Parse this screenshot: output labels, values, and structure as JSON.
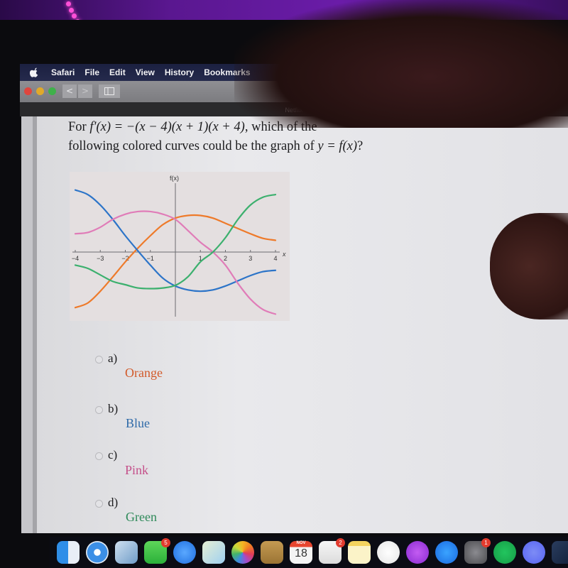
{
  "menubar": {
    "app_name": "Safari",
    "items": [
      "File",
      "Edit",
      "View",
      "History",
      "Bookmarks"
    ]
  },
  "toolbar": {
    "back_label": "<",
    "forward_label": ">"
  },
  "tab": {
    "title": "Netflix"
  },
  "question": {
    "prefix": "For ",
    "function_expr": "f′(x) = −(x − 4)(x + 1)(x + 4)",
    "suffix_line1": ", which of the",
    "line2": "following colored curves could be the graph of ",
    "target_expr": "y = f(x)",
    "end": "?"
  },
  "options": [
    {
      "letter": "a)",
      "label": "Orange",
      "color": "#d25a2a",
      "selected": false
    },
    {
      "letter": "b)",
      "label": "Blue",
      "color": "#2f6aa8",
      "selected": false
    },
    {
      "letter": "c)",
      "label": "Pink",
      "color": "#c4508a",
      "selected": false
    },
    {
      "letter": "d)",
      "label": "Green",
      "color": "#2f8a5a",
      "selected": false
    }
  ],
  "chart_data": {
    "type": "line",
    "title": "f(x)",
    "xlabel": "x",
    "ylabel": "f(x)",
    "xlim": [
      -4,
      4
    ],
    "ylim": [
      -1,
      1
    ],
    "x_ticks": [
      -4,
      -3,
      -2,
      -1,
      1,
      2,
      3,
      4
    ],
    "x_tick_labels": [
      "−4",
      "−3",
      "−2",
      "−1",
      "1",
      "2",
      "3",
      "4"
    ],
    "y_ticks": [],
    "grid": false,
    "legend": "none",
    "x": [
      -4,
      -3.5,
      -3,
      -2.5,
      -2,
      -1.5,
      -1,
      -0.5,
      0,
      0.5,
      1,
      1.5,
      2,
      2.5,
      3,
      3.5,
      4
    ],
    "series": [
      {
        "name": "Orange",
        "color": "#ee7a2a",
        "values": [
          -0.85,
          -0.78,
          -0.6,
          -0.38,
          -0.15,
          0.06,
          0.25,
          0.42,
          0.52,
          0.56,
          0.56,
          0.52,
          0.44,
          0.36,
          0.28,
          0.21,
          0.18
        ]
      },
      {
        "name": "Blue",
        "color": "#2c74c8",
        "values": [
          0.95,
          0.88,
          0.72,
          0.5,
          0.25,
          0.02,
          -0.2,
          -0.4,
          -0.52,
          -0.58,
          -0.6,
          -0.58,
          -0.52,
          -0.44,
          -0.36,
          -0.3,
          -0.28
        ]
      },
      {
        "name": "Pink",
        "color": "#e07cb8",
        "values": [
          0.28,
          0.3,
          0.38,
          0.5,
          0.58,
          0.62,
          0.62,
          0.58,
          0.5,
          0.33,
          0.15,
          0.0,
          -0.2,
          -0.48,
          -0.72,
          -0.88,
          -0.95
        ]
      },
      {
        "name": "Green",
        "color": "#3cb06e",
        "values": [
          -0.2,
          -0.25,
          -0.35,
          -0.45,
          -0.5,
          -0.55,
          -0.56,
          -0.55,
          -0.51,
          -0.38,
          -0.15,
          0.0,
          0.22,
          0.5,
          0.72,
          0.84,
          0.88
        ]
      }
    ]
  },
  "dock": {
    "apps": [
      {
        "name": "Finder",
        "badge": ""
      },
      {
        "name": "Safari",
        "badge": ""
      },
      {
        "name": "Mail",
        "badge": ""
      },
      {
        "name": "FaceTime",
        "badge": "5"
      },
      {
        "name": "Messages",
        "badge": ""
      },
      {
        "name": "Maps",
        "badge": ""
      },
      {
        "name": "Photos",
        "badge": ""
      },
      {
        "name": "Contacts",
        "badge": ""
      },
      {
        "name": "Calendar",
        "badge": "",
        "month": "NOV",
        "day": "18"
      },
      {
        "name": "Reminders",
        "badge": "2"
      },
      {
        "name": "Notes",
        "badge": ""
      },
      {
        "name": "Music",
        "badge": ""
      },
      {
        "name": "Podcasts",
        "badge": ""
      },
      {
        "name": "App Store",
        "badge": ""
      },
      {
        "name": "System Preferences",
        "badge": "1"
      },
      {
        "name": "Spotify",
        "badge": ""
      },
      {
        "name": "Discord",
        "badge": ""
      },
      {
        "name": "Steam",
        "badge": ""
      }
    ]
  }
}
